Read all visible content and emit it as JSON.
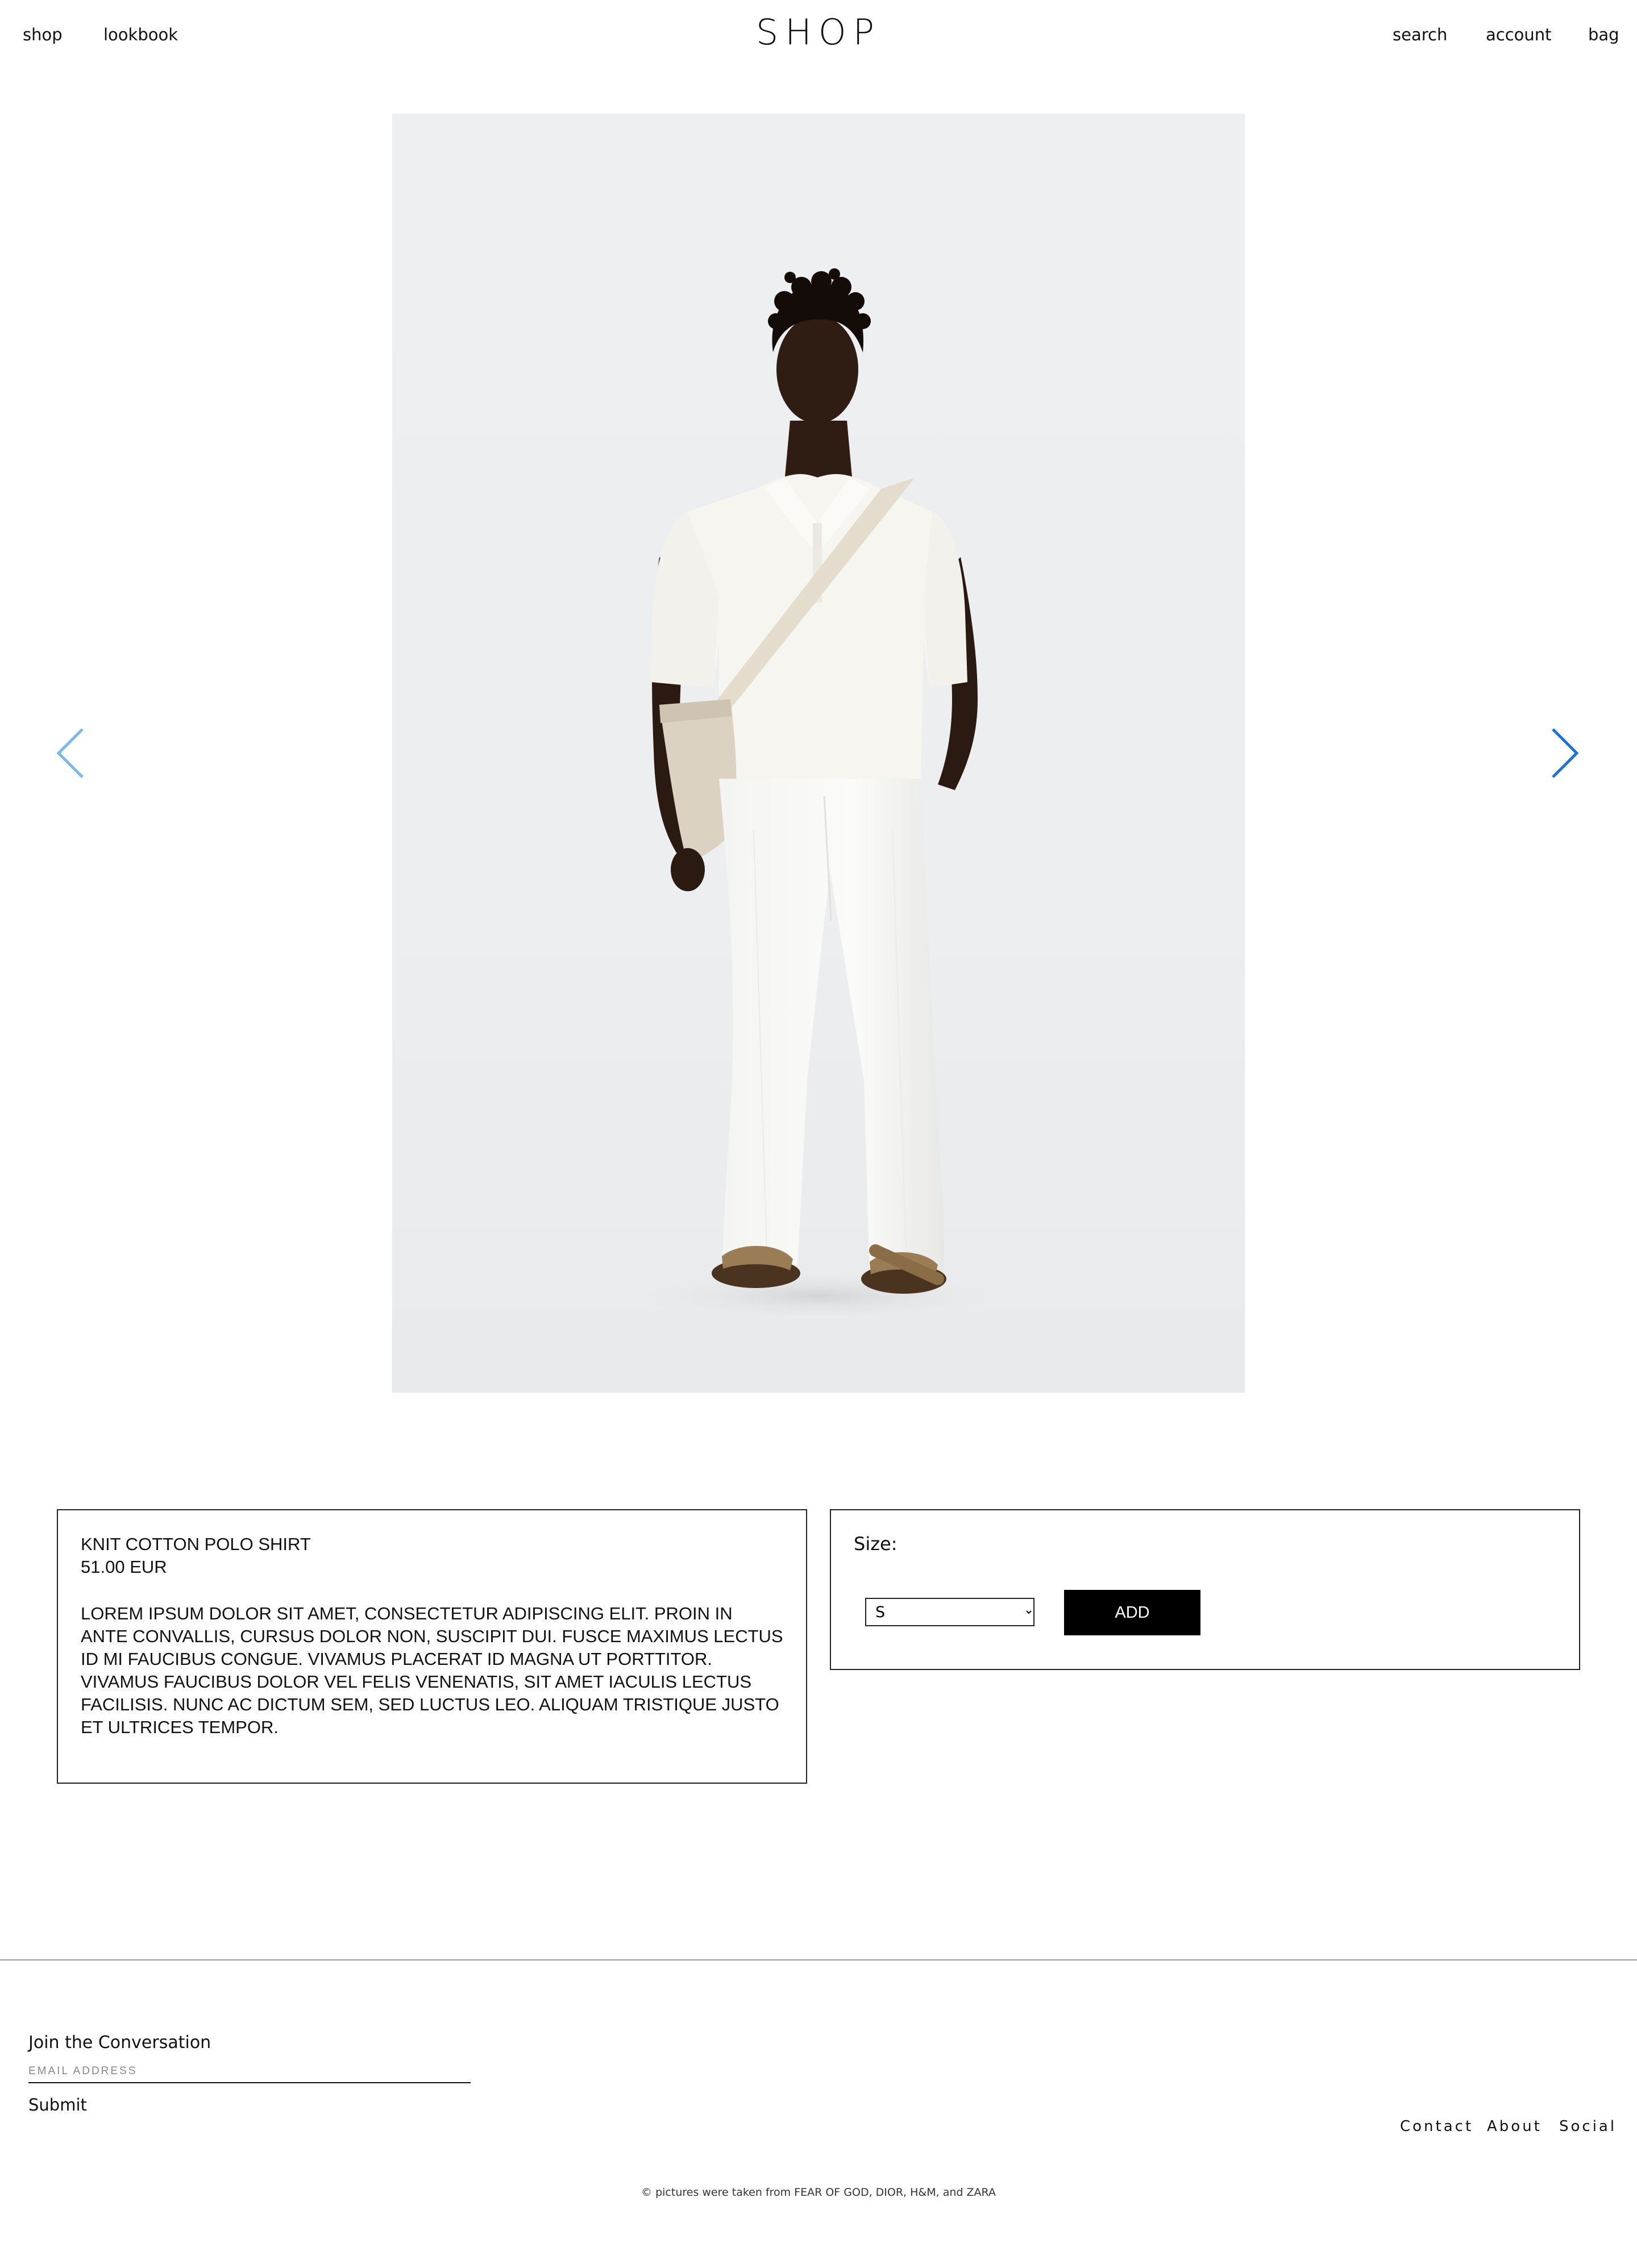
{
  "header": {
    "nav_left": [
      "shop",
      "lookbook"
    ],
    "logo": "SHOP",
    "nav_right": [
      "search",
      "account",
      "bag"
    ]
  },
  "product": {
    "image_icon": "model-wearing-white-knit-polo-and-white-trousers",
    "name": "KNIT COTTON POLO SHIRT",
    "price": "51.00 EUR",
    "description": "LOREM IPSUM DOLOR SIT AMET, CONSECTETUR ADIPISCING ELIT. PROIN IN ANTE CONVALLIS, CURSUS DOLOR NON, SUSCIPIT DUI. FUSCE MAXIMUS LECTUS ID MI FAUCIBUS CONGUE. VIVAMUS PLACERAT ID MAGNA UT PORTTITOR. VIVAMUS FAUCIBUS DOLOR VEL FELIS VENENATIS, SIT AMET IACULIS LECTUS FACILISIS. NUNC AC DICTUM SEM, SED LUCTUS LEO. ALIQUAM TRISTIQUE JUSTO ET ULTRICES TEMPOR."
  },
  "carousel": {
    "prev_icon": "chevron-left-icon",
    "next_icon": "chevron-right-icon",
    "prev_color": "#7ab8ef",
    "next_color": "#1a73d9"
  },
  "purchase": {
    "size_label": "Size:",
    "selected_size": "S",
    "add_label": "ADD"
  },
  "footer": {
    "join_title": "Join the Conversation",
    "email_placeholder": "EMAIL ADDRESS",
    "submit_label": "Submit",
    "links": [
      "Contact",
      "About",
      "Social"
    ],
    "credits": "© pictures were taken from FEAR OF GOD, DIOR, H&M, and ZARA"
  }
}
